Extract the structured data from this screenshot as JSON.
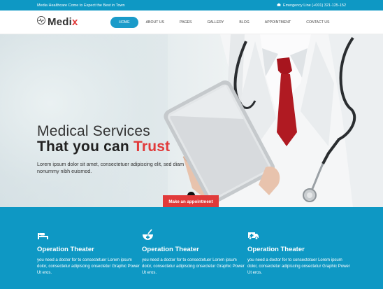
{
  "topbar": {
    "tagline": "Media Healthcare Come to Expect the Best in Town",
    "emergency": "Emergency Line (+001) 321-125-152"
  },
  "logo": {
    "name_main": "Medi",
    "name_accent": "x"
  },
  "nav": {
    "items": [
      "HOME",
      "ABOUT US",
      "PAGES",
      "GALLERY",
      "BLOG",
      "APPOINTMENT",
      "CONTACT US"
    ],
    "active": "HOME"
  },
  "hero": {
    "title_line1": "Medical Services",
    "title_line2_prefix": "That you can",
    "title_line2_accent": "Trust",
    "description": "Lorem ipsum dolor sit amet, consectetuer adipiscing elit, sed diam nonummy nibh euismod.",
    "cta": "Make an appointment"
  },
  "services": [
    {
      "icon": "hospital-bed-icon",
      "title": "Operation Theater",
      "text": "you need a doctor for to consectetuer Lorem ipsum dolor, consectetur adipiscing onsectetur Graphic Power Ut eros."
    },
    {
      "icon": "medicine-bowl-icon",
      "title": "Operation Theater",
      "text": "you need a doctor for to consectetuer Lorem ipsum dolor, consectetur adipiscing onsectetur Graphic Power Ut eros."
    },
    {
      "icon": "ambulance-icon",
      "title": "Operation Theater",
      "text": "you need a doctor for to consectetuer Lorem ipsum dolor, consectetur adipiscing onsectetur Graphic Power Ut eros."
    }
  ],
  "colors": {
    "primary": "#0e98c4",
    "accent": "#e13a3a",
    "text": "#333333"
  }
}
